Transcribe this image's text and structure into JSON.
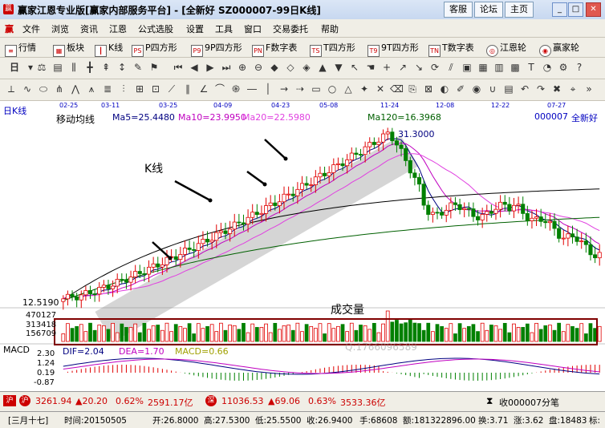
{
  "window": {
    "title": "赢家江恩专业版[赢家内部服务平台] - [全新好   SZ000007-99日K线]",
    "buttons": [
      "客服",
      "论坛",
      "主页"
    ]
  },
  "menu": [
    "文件",
    "浏览",
    "资讯",
    "江恩",
    "公式选股",
    "设置",
    "工具",
    "窗口",
    "交易委托",
    "帮助"
  ],
  "toolbar": {
    "items": [
      {
        "label": "行情",
        "icon": "quote-icon"
      },
      {
        "label": "板块",
        "icon": "sector-icon"
      },
      {
        "label": "K线",
        "icon": "kline-icon"
      },
      {
        "label": "P四方形",
        "icon": "p-square-icon"
      },
      {
        "label": "9P四方形",
        "icon": "9p-square-icon"
      },
      {
        "label": "F数字表",
        "icon": "f-table-icon"
      },
      {
        "label": "T四方形",
        "icon": "t-square-icon"
      },
      {
        "label": "9T四方形",
        "icon": "9t-square-icon"
      },
      {
        "label": "T数字表",
        "icon": "t-table-icon"
      },
      {
        "label": "江恩轮",
        "icon": "gann-wheel-icon"
      },
      {
        "label": "赢家轮",
        "icon": "winner-wheel-icon"
      }
    ],
    "period_label": "日"
  },
  "chart": {
    "period": "日K线",
    "indicator_name": "移动均线",
    "ma5": "Ma5=25.4480",
    "ma10": "Ma10=23.9950",
    "ma20": "Ma20=22.5980",
    "ma120": "Ma120=16.3968",
    "stock_code": "000007",
    "stock_name": "全新好",
    "dates": [
      "02-25",
      "03-11",
      "03-25",
      "04-09",
      "04-23",
      "05-08",
      "11-24",
      "12-08",
      "12-22",
      "07-27"
    ],
    "high_price_label": "31.3000",
    "low_price_label": "12.5190",
    "annotation_kline": "K线",
    "annotation_volume": "成交量",
    "volume_ticks": [
      "470127",
      "313418",
      "156709"
    ],
    "macd_label": "MACD",
    "dif": "DIF=2.04",
    "dea": "DEA=1.70",
    "macd": "MACD=0.66",
    "macd_ticks": [
      "2.30",
      "1.24",
      "0.19",
      "-0.87"
    ],
    "watermark_code": "Q:1766096589",
    "colors": {
      "up": "#e00000",
      "down": "#008000",
      "ma5": "#000080",
      "ma10": "#c000c0",
      "ma20": "#e040e0",
      "ma120": "#006000",
      "highlight_box": "#800000"
    }
  },
  "chart_data": {
    "type": "candlestick",
    "title": "日K线",
    "series": [
      {
        "name": "Ma5",
        "values": [
          25.448
        ]
      },
      {
        "name": "Ma10",
        "values": [
          23.995
        ]
      },
      {
        "name": "Ma20",
        "values": [
          22.598
        ]
      },
      {
        "name": "Ma120",
        "values": [
          16.3968
        ]
      }
    ],
    "ylim": [
      12.519,
      31.3
    ],
    "x_ticks": [
      "02-25",
      "03-11",
      "03-25",
      "04-09",
      "04-23",
      "05-08",
      "11-24",
      "12-08",
      "12-22",
      "07-27"
    ]
  },
  "ticker_bar": {
    "sh_index": "3261.94",
    "sh_change": "▲20.20",
    "sh_pct": "0.62%",
    "sh_amount": "2591.17亿",
    "sz_index": "11036.53",
    "sz_change": "▲69.06",
    "sz_pct": "0.63%",
    "sz_amount": "3533.36亿",
    "right_text": "收000007分笔"
  },
  "status": {
    "lunar": "[三月十七]",
    "time": "时间:20150505",
    "open": "开:26.8000",
    "high": "高:27.5300",
    "low": "低:25.5500",
    "close": "收:26.9400",
    "hand": "手:68608",
    "amount": "额:181322896.00",
    "turnover": "换:3.71",
    "rise": "涨:3.62",
    "pan": "盘:18483",
    "shi": "标:"
  }
}
